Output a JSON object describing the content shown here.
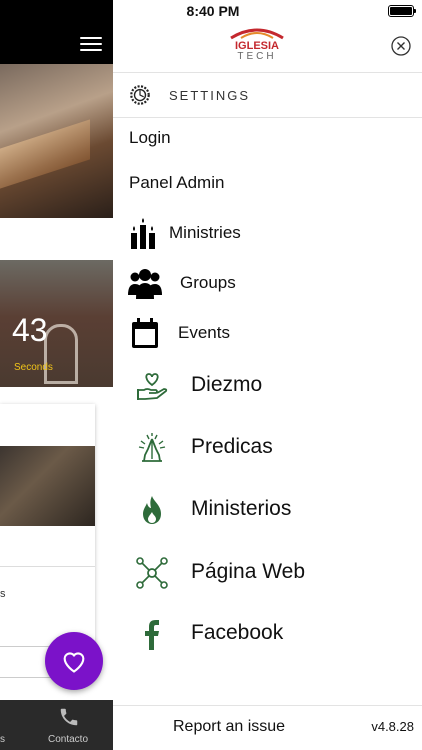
{
  "status_bar": {
    "time": "8:40 PM"
  },
  "background": {
    "countdown_value": "43",
    "countdown_unit": "Seconds",
    "card_text_fragment": "s",
    "tab_contact_label": "Contacto",
    "tab_left_fragment": "s"
  },
  "drawer": {
    "logo_top": "IGLESIA",
    "logo_bottom": "TECH",
    "settings_label": "SETTINGS",
    "text_items": [
      "Login",
      "Panel Admin"
    ],
    "icon_items": [
      {
        "label": "Ministries",
        "icon": "candles-icon"
      },
      {
        "label": "Groups",
        "icon": "people-icon"
      },
      {
        "label": "Events",
        "icon": "calendar-icon"
      }
    ],
    "big_items": [
      {
        "label": "Diezmo",
        "icon": "hand-heart-icon"
      },
      {
        "label": "Predicas",
        "icon": "praying-hands-icon"
      },
      {
        "label": "Ministerios",
        "icon": "flame-icon"
      },
      {
        "label": "Página Web",
        "icon": "network-icon"
      },
      {
        "label": "Facebook",
        "icon": "facebook-icon"
      }
    ],
    "footer": {
      "report_label": "Report an issue",
      "version": "v4.8.28"
    }
  },
  "colors": {
    "accent_green": "#2e6b3a",
    "fab_purple": "#7b12c9",
    "logo_red": "#c4282e"
  }
}
